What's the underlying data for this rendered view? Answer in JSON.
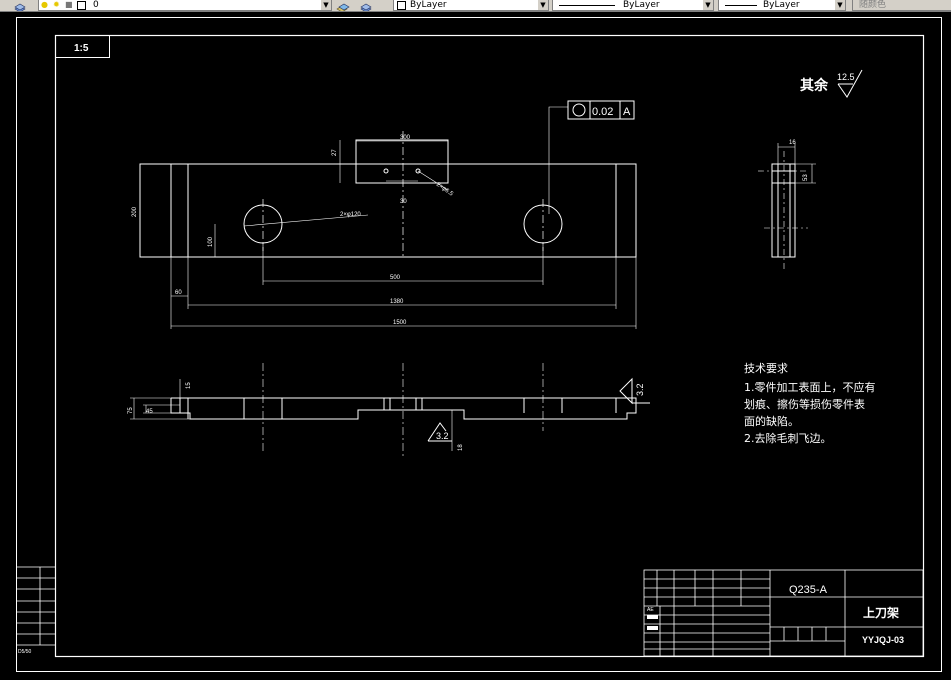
{
  "toolbar": {
    "layer_value": "0",
    "color_value": "ByLayer",
    "linetype_value": "ByLayer",
    "lineweight_value": "ByLayer",
    "plotstyle_value": "随颜色"
  },
  "drawing": {
    "scale_label": "1:5",
    "roughness_prefix": "其余",
    "roughness_value": "12.5",
    "tolerance_value": "0.02",
    "datum_label": "A",
    "top_view": {
      "dim_300": "300",
      "dim_27": "27",
      "dim_phi": "2×φ6.5",
      "dim_30": "30",
      "dim_200": "200",
      "dim_hole": "2×φ120",
      "dim_100": "100",
      "dim_500": "500",
      "dim_60": "60",
      "dim_1380": "1380",
      "dim_1500": "1500"
    },
    "side_view": {
      "dim_16": "16",
      "dim_53": "53"
    },
    "front_view": {
      "dim_15": "15",
      "dim_75": "75",
      "dim_45": "45",
      "dim_18": "18",
      "rough_a": "3.2",
      "rough_b": "3.2"
    },
    "tech_req": {
      "title": "技术要求",
      "line1": "1.零件加工表面上，不应有",
      "line2": "划痕、擦伤等损伤零件表",
      "line3": "面的缺陷。",
      "line4": "2.去除毛刺飞边。"
    },
    "title_block": {
      "material": "Q235-A",
      "part_name": "上刀架",
      "drawing_no": "YYJQJ-03",
      "tag": "AE",
      "side_tag": "D5/50"
    }
  }
}
